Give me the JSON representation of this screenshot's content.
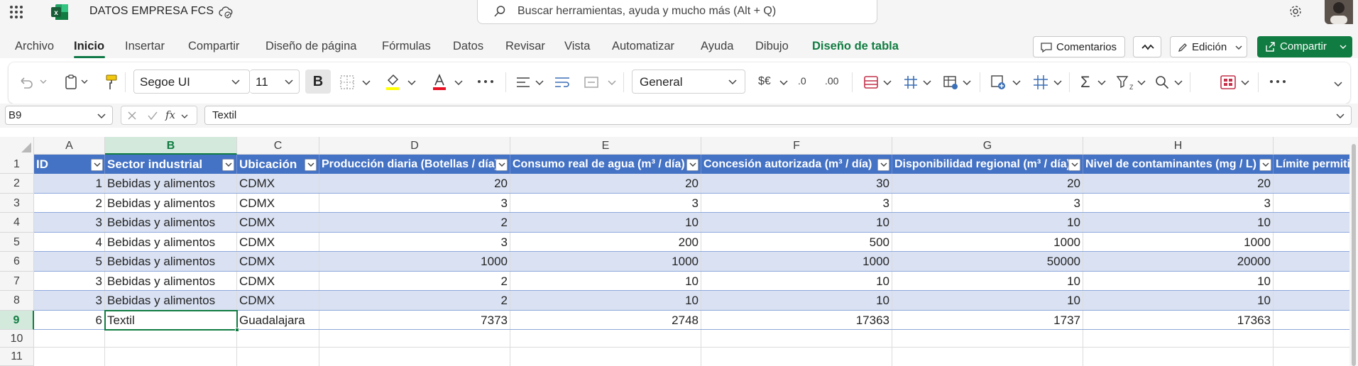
{
  "titlebar": {
    "doc_title": "DATOS EMPRESA FCS",
    "search_placeholder": "Buscar herramientas, ayuda y mucho más (Alt + Q)"
  },
  "menu": {
    "tabs": [
      {
        "label": "Archivo"
      },
      {
        "label": "Inicio"
      },
      {
        "label": "Insertar"
      },
      {
        "label": "Compartir"
      },
      {
        "label": "Diseño de página"
      },
      {
        "label": "Fórmulas"
      },
      {
        "label": "Datos"
      },
      {
        "label": "Revisar"
      },
      {
        "label": "Vista"
      },
      {
        "label": "Automatizar"
      },
      {
        "label": "Ayuda"
      },
      {
        "label": "Dibujo"
      },
      {
        "label": "Diseño de tabla"
      }
    ],
    "active_tab": "Inicio",
    "comments_label": "Comentarios",
    "edit_label": "Edición",
    "share_label": "Compartir"
  },
  "ribbon": {
    "font_name": "Segoe UI",
    "font_size": "11",
    "bold_label": "B",
    "number_format": "General",
    "currency_label": "$€",
    "decimal_dec": ".0",
    "decimal_inc": ".00",
    "fx_label": "fx"
  },
  "formula_bar": {
    "name_box": "B9",
    "formula": "Textil"
  },
  "sheet": {
    "columns": [
      "A",
      "B",
      "C",
      "D",
      "E",
      "F",
      "G",
      "H"
    ],
    "selected_column": "B",
    "row_numbers": [
      "1",
      "2",
      "3",
      "4",
      "5",
      "6",
      "7",
      "8",
      "9",
      "10",
      "11"
    ],
    "selected_row": "9",
    "headers": [
      "ID",
      "Sector industrial",
      "Ubicación",
      "Producción diaria (Botellas / día)",
      "Consumo real de agua (m³ / día)",
      "Concesión autorizada (m³ / día)",
      "Disponibilidad regional (m³ / día)",
      "Nivel de contaminantes (mg / L)",
      "Límite permiti"
    ],
    "rows": [
      [
        "1",
        "Bebidas y alimentos",
        "CDMX",
        "20",
        "20",
        "30",
        "20",
        "20"
      ],
      [
        "2",
        "Bebidas y alimentos",
        "CDMX",
        "3",
        "3",
        "3",
        "3",
        "3"
      ],
      [
        "3",
        "Bebidas y alimentos",
        "CDMX",
        "2",
        "10",
        "10",
        "10",
        "10"
      ],
      [
        "4",
        "Bebidas y alimentos",
        "CDMX",
        "3",
        "200",
        "500",
        "1000",
        "1000"
      ],
      [
        "5",
        "Bebidas y alimentos",
        "CDMX",
        "1000",
        "1000",
        "1000",
        "50000",
        "20000"
      ],
      [
        "3",
        "Bebidas y alimentos",
        "CDMX",
        "2",
        "10",
        "10",
        "10",
        "10"
      ],
      [
        "3",
        "Bebidas y alimentos",
        "CDMX",
        "2",
        "10",
        "10",
        "10",
        "10"
      ],
      [
        "6",
        "Textil",
        "Guadalajara",
        "7373",
        "2748",
        "17363",
        "1737",
        "17363"
      ]
    ]
  },
  "colors": {
    "brand_green": "#107c41",
    "table_header": "#4472c4",
    "table_band": "#d9e1f2"
  }
}
